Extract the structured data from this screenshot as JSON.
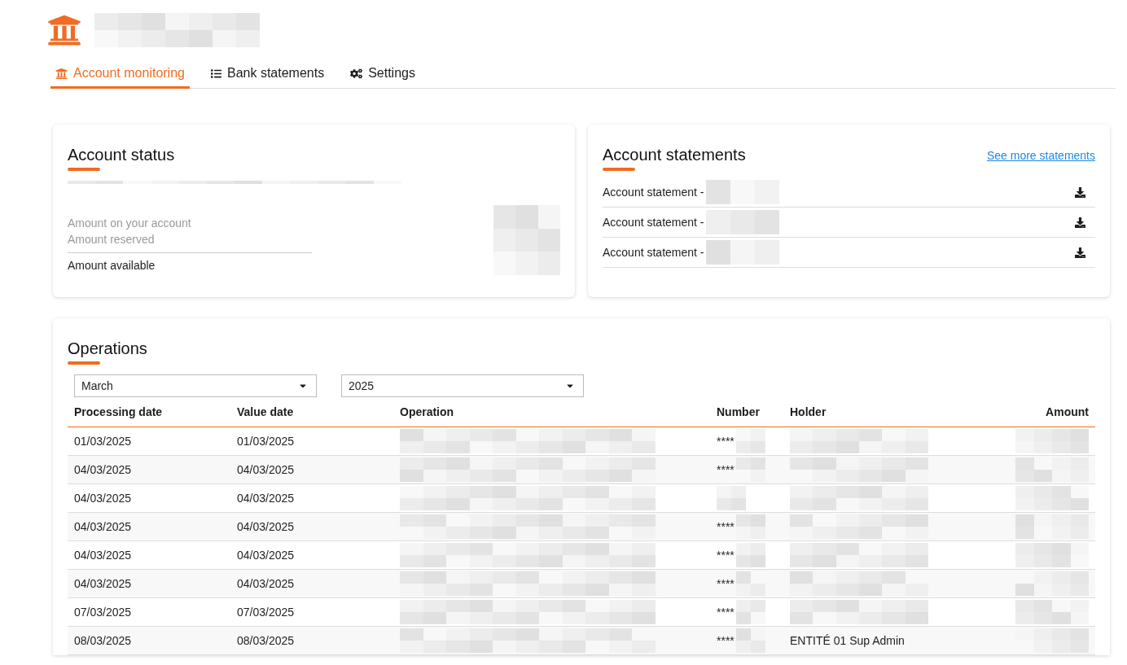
{
  "tabs": [
    {
      "label": "Account monitoring",
      "selected": true
    },
    {
      "label": "Bank statements",
      "selected": false
    },
    {
      "label": "Settings",
      "selected": false
    }
  ],
  "account_status": {
    "title": "Account status",
    "rows": [
      {
        "label": "Amount on your account",
        "kind": "secondary"
      },
      {
        "label": "Amount reserved",
        "kind": "secondary"
      },
      {
        "label": "Amount available",
        "kind": "total"
      }
    ]
  },
  "account_statements": {
    "title": "Account statements",
    "link": "See more statements",
    "items": [
      "Account statement -",
      "Account statement -",
      "Account statement -"
    ]
  },
  "operations": {
    "title": "Operations",
    "filters": [
      {
        "value": "March"
      },
      {
        "value": "2025"
      }
    ],
    "columns": [
      "Processing date",
      "Value date",
      "Operation",
      "Number",
      "Holder",
      "Amount"
    ],
    "rows": [
      {
        "processing_date": "01/03/2025",
        "value_date": "01/03/2025",
        "number": "****"
      },
      {
        "processing_date": "04/03/2025",
        "value_date": "04/03/2025",
        "number": "****"
      },
      {
        "processing_date": "04/03/2025",
        "value_date": "04/03/2025"
      },
      {
        "processing_date": "04/03/2025",
        "value_date": "04/03/2025",
        "number": "****"
      },
      {
        "processing_date": "04/03/2025",
        "value_date": "04/03/2025",
        "number": "****"
      },
      {
        "processing_date": "04/03/2025",
        "value_date": "04/03/2025",
        "number": "****"
      },
      {
        "processing_date": "07/03/2025",
        "value_date": "07/03/2025",
        "number": "****"
      },
      {
        "processing_date": "08/03/2025",
        "value_date": "08/03/2025",
        "number": "****",
        "holder": "ENTITÉ 01 Sup Admin"
      }
    ]
  }
}
